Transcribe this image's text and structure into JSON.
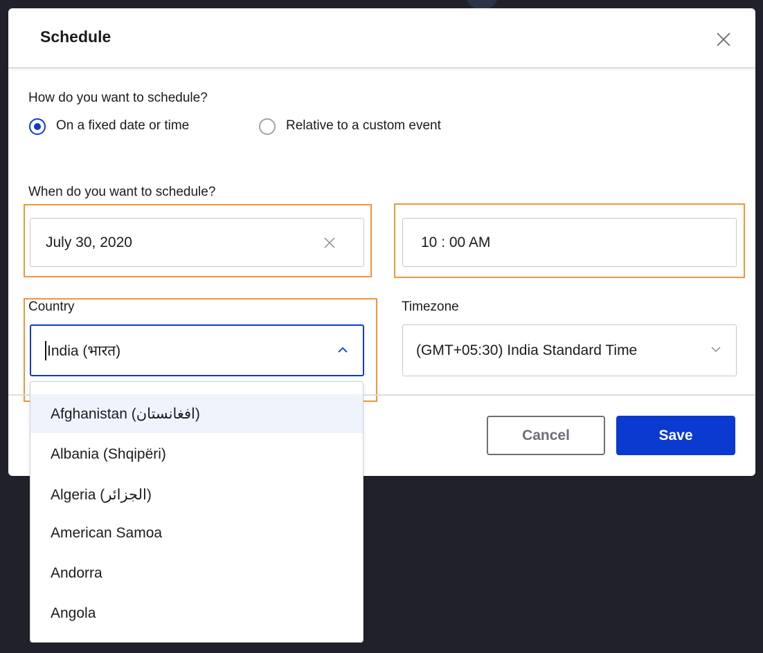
{
  "dialog": {
    "title": "Schedule",
    "close_icon": "close-icon"
  },
  "schedule_type": {
    "question": "How do you want to schedule?",
    "options": [
      {
        "label": "On a fixed date or time",
        "selected": true
      },
      {
        "label": "Relative to a custom event",
        "selected": false
      }
    ]
  },
  "when": {
    "question": "When do you want to schedule?",
    "date_value": "July 30, 2020",
    "time_value": "10 : 00 AM"
  },
  "country": {
    "label": "Country",
    "value": "India (भारत)",
    "options": [
      "Afghanistan (افغانستان)",
      "Albania (Shqipëri)",
      "Algeria (الجزائر)",
      "American Samoa",
      "Andorra",
      "Angola"
    ],
    "highlighted_index": 0
  },
  "timezone": {
    "label": "Timezone",
    "value": "(GMT+05:30) India Standard Time"
  },
  "footer": {
    "cancel_label": "Cancel",
    "save_label": "Save"
  },
  "colors": {
    "accent": "#0a3ad0",
    "highlight_outline": "#f0953a",
    "backdrop": "#21212b"
  }
}
